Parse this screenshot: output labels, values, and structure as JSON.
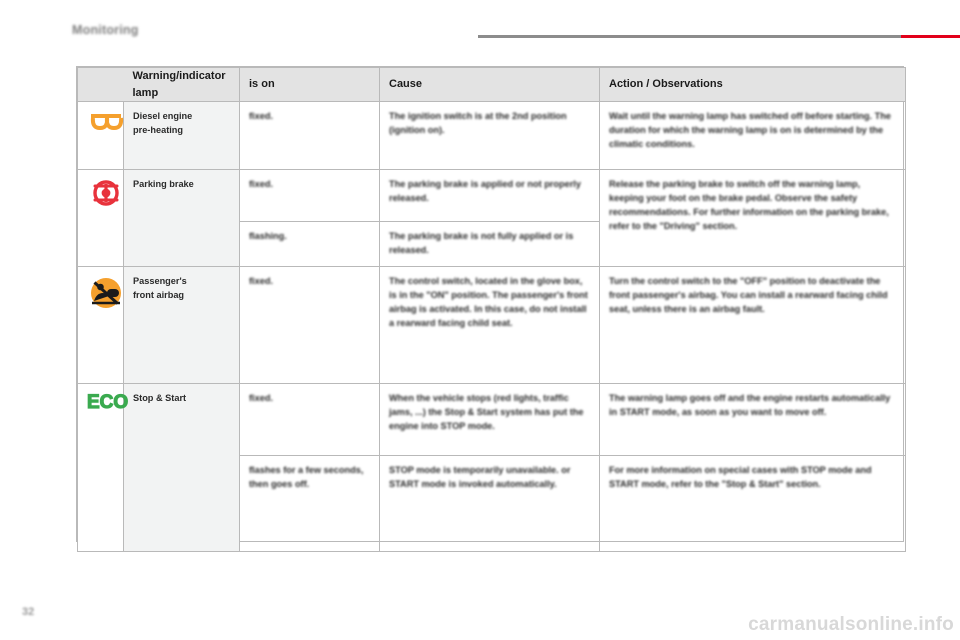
{
  "header": {
    "section_title": "Monitoring",
    "rule_color": "#8c8c8c",
    "accent_color": "#e2001a"
  },
  "table": {
    "columns": [
      {
        "key": "icon",
        "label": ""
      },
      {
        "key": "lamp",
        "label": "Warning/indicator lamp"
      },
      {
        "key": "is_on",
        "label": "is on"
      },
      {
        "key": "cause",
        "label": "Cause"
      },
      {
        "key": "action",
        "label": "Action / Observations"
      }
    ],
    "rows": [
      {
        "icon_name": "diesel-preheating-icon",
        "icon_color": "#f5a02d",
        "lamp": "Diesel engine\npre-heating",
        "lamp_line1": "Diesel engine",
        "lamp_line2": "pre-heating",
        "entries": [
          {
            "is_on": "fixed.",
            "cause": "The ignition switch is at the 2nd position (ignition on).",
            "action": "Wait until the warning lamp has switched off before starting. The duration for which the warning lamp is on is determined by the climatic conditions."
          }
        ]
      },
      {
        "icon_name": "parking-brake-icon",
        "icon_color": "#e8323c",
        "lamp_line1": "Parking brake",
        "lamp_line2": "",
        "entries": [
          {
            "is_on": "fixed.",
            "cause": "The parking brake is applied or not properly released.",
            "action": "Release the parking brake to switch off the warning lamp, keeping your foot on the brake pedal. Observe the safety recommendations. For further information on the parking brake, refer to the \"Driving\" section."
          },
          {
            "is_on": "flashing.",
            "cause": "The parking brake is not fully applied or is released.",
            "action": ""
          }
        ]
      },
      {
        "icon_name": "passenger-airbag-off-icon",
        "icon_color": "#f5a02d",
        "lamp_line1": "Passenger's",
        "lamp_line2": "front airbag",
        "entries": [
          {
            "is_on": "fixed.",
            "cause": "The control switch, located in the glove box, is in the \"ON\" position. The passenger's front airbag is activated. In this case, do not install a rearward facing child seat.",
            "action": "Turn the control switch to the \"OFF\" position to deactivate the front passenger's airbag. You can install a rearward facing child seat, unless there is an airbag fault."
          }
        ]
      },
      {
        "icon_name": "eco-stop-start-icon",
        "icon_color": "#3aaa4f",
        "icon_text": "ECO",
        "lamp_line1": "Stop & Start",
        "lamp_line2": "",
        "entries": [
          {
            "is_on": "fixed.",
            "cause": "When the vehicle stops (red lights, traffic jams, ...) the Stop & Start system has put the engine into STOP mode.",
            "action": "The warning lamp goes off and the engine restarts automatically in START mode, as soon as you want to move off."
          },
          {
            "is_on": "flashes for a few seconds, then goes off.",
            "cause": "STOP mode is temporarily unavailable. or START mode is invoked automatically.",
            "action": "For more information on special cases with STOP mode and START mode, refer to the \"Stop & Start\" section."
          }
        ]
      }
    ]
  },
  "footer": {
    "page_number": "32",
    "watermark": "carmanualsonline.info"
  }
}
